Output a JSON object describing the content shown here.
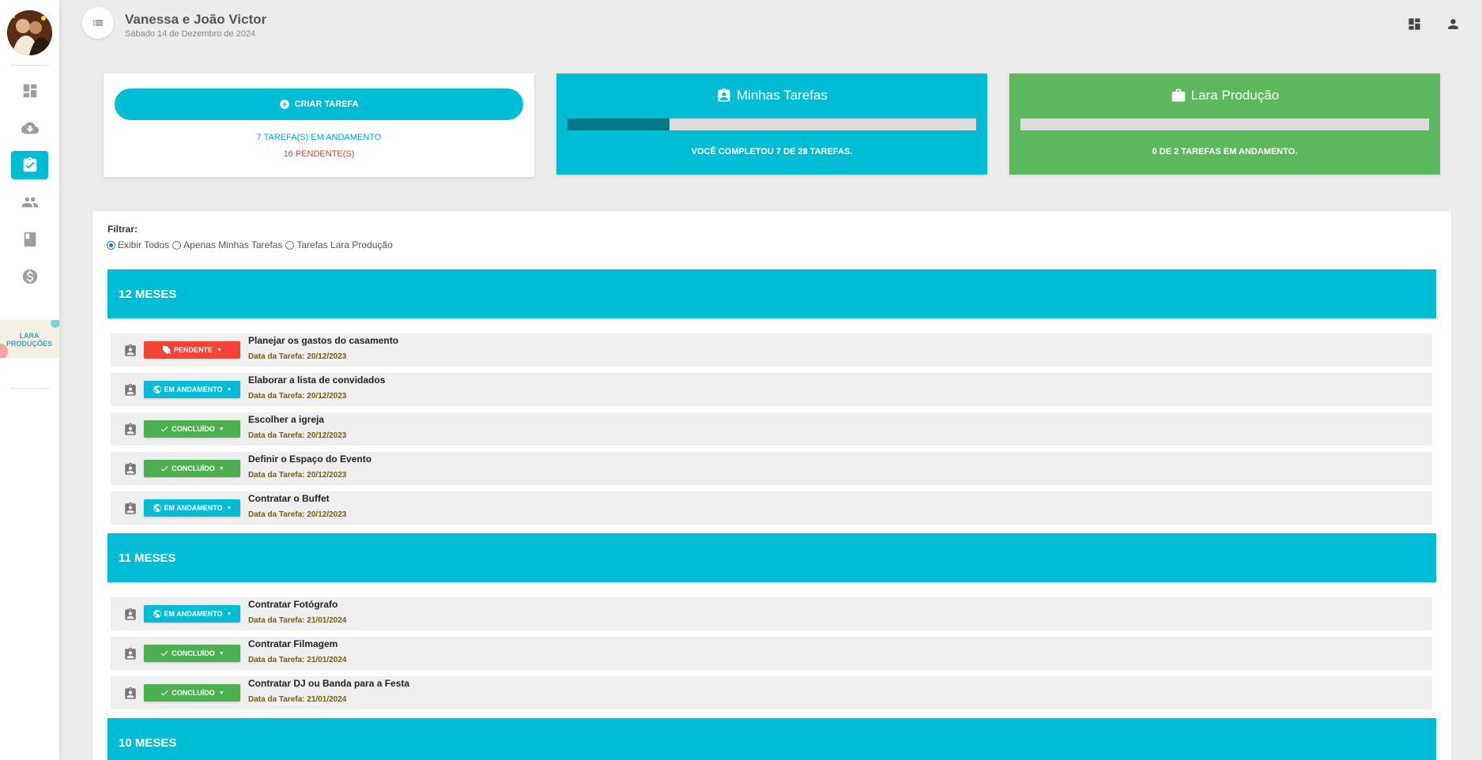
{
  "header": {
    "title": "Vanessa e João Victor",
    "date": "Sábado 14 de Dezembro de 2024"
  },
  "sidebar": {
    "items": [
      {
        "icon": "dashboard-icon"
      },
      {
        "icon": "cloud-download-icon"
      },
      {
        "icon": "task-check-icon",
        "active": true
      },
      {
        "icon": "people-icon"
      },
      {
        "icon": "book-icon"
      },
      {
        "icon": "dollar-icon"
      }
    ],
    "brand_logo_text": "LARA PRODUÇÕES"
  },
  "create_card": {
    "button_label": "CRIAR TAREFA",
    "in_progress_text": "7 TAREFA(S) EM ANDAMENTO",
    "pending_text": "16 PENDENTE(S)"
  },
  "my_tasks_card": {
    "title": "Minhas Tarefas",
    "progress_fraction": 0.25,
    "subtitle": "VOCÊ COMPLETOU 7 DE 28 TAREFAS.",
    "color": "#00bcd4",
    "fill_color": "#00798a"
  },
  "lara_card": {
    "title": "Lara Produção",
    "progress_fraction": 0,
    "subtitle": "0 DE 2 TAREFAS EM ANDAMENTO.",
    "color": "#5cb85c"
  },
  "filter": {
    "label": "Filtrar:",
    "options": [
      "Exibir Todos",
      "Apenas Minhas Tarefas",
      "Tarefas Lara Produção"
    ],
    "selected": "Exibir Todos"
  },
  "date_prefix": "Data da Tarefa:",
  "status_labels": {
    "pendente": "PENDENTE",
    "andamento": "EM ANDAMENTO",
    "concluido": "CONCLUÍDO"
  },
  "groups": [
    {
      "title": "12 MESES",
      "tasks": [
        {
          "name": "Planejar os gastos do casamento",
          "date": "20/12/2023",
          "status": "pendente"
        },
        {
          "name": "Elaborar a lista de convidados",
          "date": "20/12/2023",
          "status": "andamento"
        },
        {
          "name": "Escolher a igreja",
          "date": "20/12/2023",
          "status": "concluido"
        },
        {
          "name": "Definir o Espaço do Evento",
          "date": "20/12/2023",
          "status": "concluido"
        },
        {
          "name": "Contratar o Buffet",
          "date": "20/12/2023",
          "status": "andamento"
        }
      ]
    },
    {
      "title": "11 MESES",
      "tasks": [
        {
          "name": "Contratar Fotógrafo",
          "date": "21/01/2024",
          "status": "andamento"
        },
        {
          "name": "Contratar Filmagem",
          "date": "21/01/2024",
          "status": "concluido"
        },
        {
          "name": "Contratar DJ ou Banda para a Festa",
          "date": "21/01/2024",
          "status": "concluido"
        }
      ]
    },
    {
      "title": "10 MESES",
      "tasks": []
    }
  ]
}
